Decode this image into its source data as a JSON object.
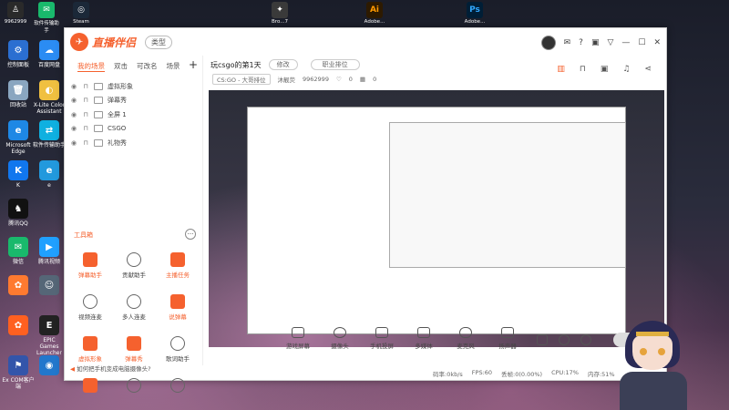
{
  "desktop": {
    "top_icons": [
      {
        "label": "9962999",
        "color": "#2a2a2a",
        "glyph": "user-icon"
      },
      {
        "label": "软件传输助手",
        "color": "#19b96c",
        "glyph": "wechat-icon"
      },
      {
        "label": "Steam",
        "color": "#1b2838",
        "glyph": "steam-icon"
      },
      {
        "label": "Bro...7",
        "color": "#3a3a3a",
        "glyph": "app-icon"
      },
      {
        "label": "Adobe...",
        "color": "#ff9a00",
        "glyph": "ai-icon"
      },
      {
        "label": "Adobe...",
        "color": "#31a8ff",
        "glyph": "ps-icon"
      }
    ],
    "left_icons": [
      {
        "label": "控制面板",
        "color": "#2b6fd1"
      },
      {
        "label": "百度网盘",
        "color": "#2b8cf3"
      },
      {
        "label": "回收站",
        "color": "#8aa6c0"
      },
      {
        "label": "X-Lite Color Assistant",
        "color": "#f0c040"
      },
      {
        "label": "Microsoft Edge",
        "color": "#1e88e5"
      },
      {
        "label": "软件传输助手",
        "color": "#0fb0e0"
      },
      {
        "label": "K",
        "color": "#1177ee"
      },
      {
        "label": "e",
        "color": "#2299dd"
      },
      {
        "label": "腾讯QQ",
        "color": "#111111"
      },
      {
        "label": "微信",
        "color": "#19b96c"
      },
      {
        "label": "腾讯视频",
        "color": "#20a0ff"
      },
      {
        "label": "",
        "color": "#ff7a30"
      },
      {
        "label": "",
        "color": "#556677"
      },
      {
        "label": "EPIC Games Launcher",
        "color": "#222222"
      },
      {
        "label": "",
        "color": "#ff6020"
      },
      {
        "label": "",
        "color": "#2277cc"
      },
      {
        "label": "Ex COM客户端",
        "color": "#3355aa"
      }
    ]
  },
  "app": {
    "name": "直播伴侣",
    "type_label": "类型",
    "window_controls": [
      "avatar",
      "mail-icon",
      "help-icon",
      "crop-icon",
      "filter-icon",
      "minimize-icon",
      "maximize-icon",
      "close-icon"
    ]
  },
  "scenes": {
    "tabs": [
      "我的场景",
      "双击",
      "可改名",
      "场景"
    ],
    "add": "+",
    "sources": [
      "虚拟形象",
      "弹幕秀",
      "全屏 1",
      "CSGO",
      "礼物秀"
    ]
  },
  "toolbox": {
    "title": "工具箱",
    "more": "···",
    "tools": [
      {
        "label": "弹幕助手",
        "hot": true
      },
      {
        "label": "贡献助手",
        "hot": false
      },
      {
        "label": "主播任务",
        "hot": true
      },
      {
        "label": "视频连麦",
        "hot": false
      },
      {
        "label": "多人连麦",
        "hot": false
      },
      {
        "label": "说弹幕",
        "hot": true
      },
      {
        "label": "虚拟形象",
        "hot": true
      },
      {
        "label": "弹幕秀",
        "hot": true
      },
      {
        "label": "歌词助手",
        "hot": false
      },
      {
        "label": "",
        "hot": true
      },
      {
        "label": "",
        "hot": false
      },
      {
        "label": "",
        "hot": false
      }
    ]
  },
  "tip": "如何把手机变成电脑摄像头?",
  "room": {
    "title": "玩csgo的第1天",
    "edit": "修改",
    "rank": "职业排位",
    "category": "CS:GO - 大哥排位",
    "host": "沐靓荧",
    "id": "9962999",
    "likes": "0",
    "gifts": "0"
  },
  "controls": [
    "游戏屏幕",
    "摄像头",
    "手机投屏",
    "多媒体",
    "麦克风",
    "扬声器"
  ],
  "live_button": "",
  "status": {
    "bitrate": "码率:0kb/s",
    "fps": "FPS:60",
    "drop": "丢帧:0(0.00%)",
    "cpu": "CPU:17%",
    "mem": "内存:51%"
  },
  "colors": {
    "accent": "#f5612e",
    "text": "#333333"
  }
}
